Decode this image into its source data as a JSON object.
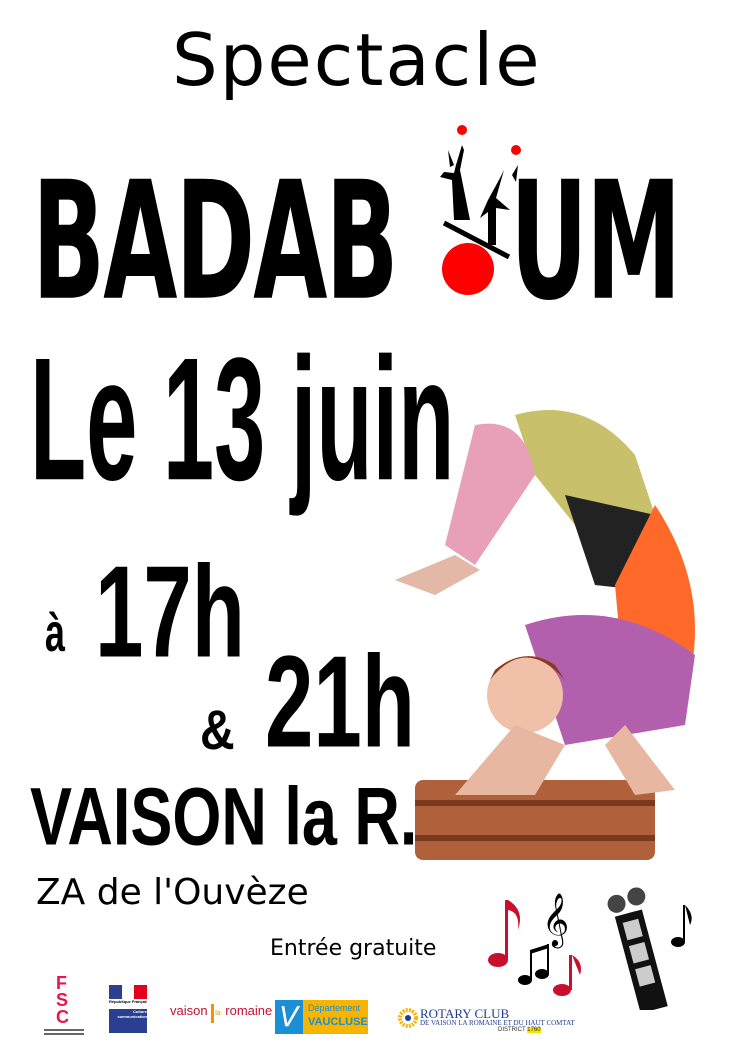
{
  "poster": {
    "kicker": "Spectacle",
    "title_left": "BADAB",
    "title_right": "UM",
    "date": "Le 13 juin",
    "at": "à",
    "time1": "17h",
    "and": "&",
    "time2": "21h",
    "place": "VAISON la R.",
    "address": "ZA de l'Ouvèze",
    "entry": "Entrée gratuite"
  },
  "sponsors": {
    "fsc": "FSC",
    "republique": "République Française",
    "ministere": "Culture communication",
    "vaison_left": "vaison",
    "vaison_mid": "la",
    "vaison_right": "romaine",
    "dept_line1": "Département",
    "dept_line2": "VAUCLUSE",
    "rotary_line1": "ROTARY CLUB",
    "rotary_line2": "DE VAISON LA ROMAINE ET DU HAUT COMTAT",
    "rotary_district": "DISTRICT",
    "rotary_district_no": "1760"
  },
  "colors": {
    "red": "#ff0000",
    "fsc": "#e8174a",
    "vaucluse_blue": "#1a8fd6",
    "vaucluse_yellow": "#f7b500",
    "rotary_blue": "#1d3d8f"
  }
}
